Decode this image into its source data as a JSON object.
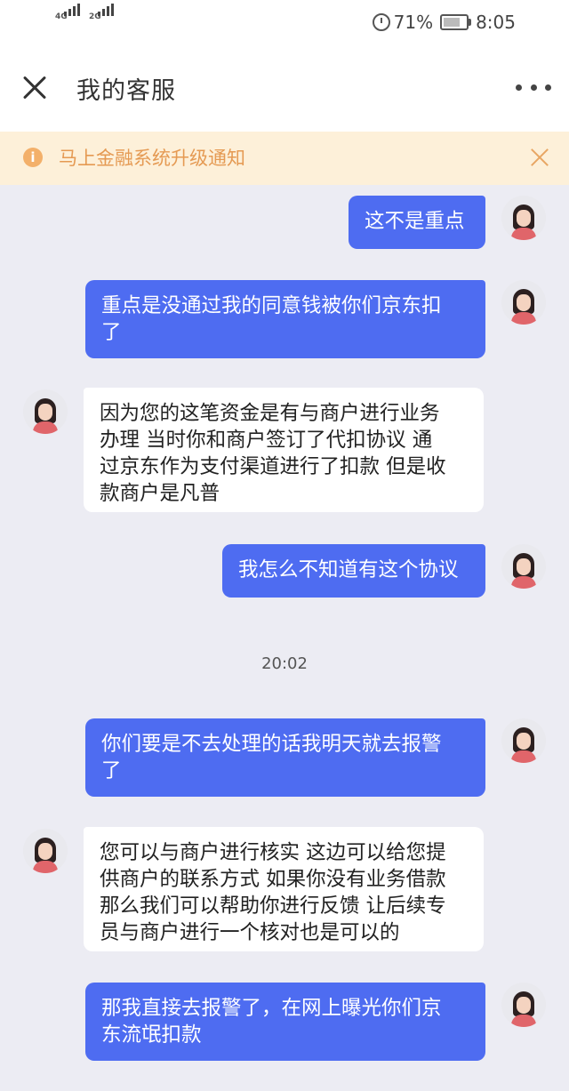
{
  "status_bar": {
    "signal1": "4G",
    "signal2": "2G",
    "battery": "71%",
    "time": "8:05"
  },
  "nav": {
    "title": "我的客服"
  },
  "notice": {
    "icon": "i",
    "text": "马上金融系统升级通知"
  },
  "messages": [
    {
      "sender": "user",
      "lines": [
        "这不是重点"
      ]
    },
    {
      "sender": "user",
      "lines": [
        "重点是没通过我的同意钱被你们京东扣",
        "了"
      ]
    },
    {
      "sender": "agent",
      "lines": [
        "因为您的这笔资金是有与商户进行业务",
        "办理 当时你和商户签订了代扣协议 通",
        "过京东作为支付渠道进行了扣款 但是收",
        "款商户是凡普"
      ]
    },
    {
      "sender": "user",
      "lines": [
        "我怎么不知道有这个协议"
      ]
    },
    {
      "sender": "user",
      "lines": [
        "你们要是不去处理的话我明天就去报警",
        "了"
      ]
    },
    {
      "sender": "agent",
      "lines": [
        "您可以与商户进行核实 这边可以给您提",
        "供商户的联系方式 如果你没有业务借款",
        "那么我们可以帮助你进行反馈 让后续专",
        "员与商户进行一个核对也是可以的"
      ]
    },
    {
      "sender": "user",
      "lines": [
        "那我直接去报警了，在网上曝光你们京",
        "东流氓扣款"
      ]
    }
  ],
  "timestamp": "20:02",
  "colors": {
    "user_bubble": "#4e6cf1",
    "agent_bubble": "#ffffff",
    "chat_bg": "#ececf3",
    "notice_bg": "#fdf0d9",
    "notice_text": "#e59a53"
  }
}
